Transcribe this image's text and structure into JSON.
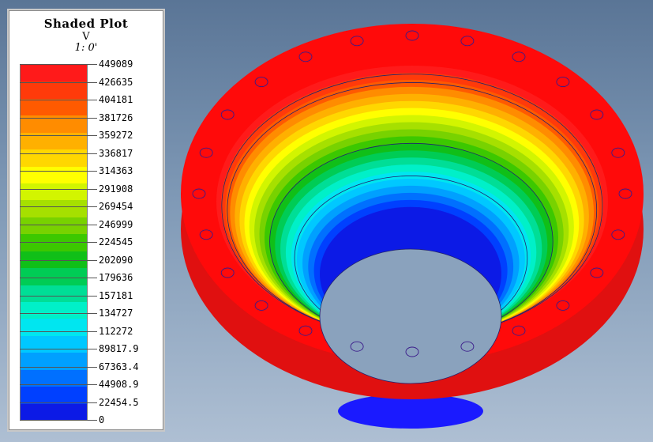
{
  "legend": {
    "title": "Shaded Plot",
    "quantity": "V",
    "scale": "1: 0'",
    "labels": [
      "449089",
      "426635",
      "404181",
      "381726",
      "359272",
      "336817",
      "314363",
      "291908",
      "269454",
      "246999",
      "224545",
      "202090",
      "179636",
      "157181",
      "134727",
      "112272",
      "89817.9",
      "67363.4",
      "44908.9",
      "22454.5",
      "0"
    ],
    "band_colors": [
      "#ff1a1a",
      "#ff3a0a",
      "#ff5a00",
      "#ff8c00",
      "#ffb000",
      "#ffd700",
      "#ffff00",
      "#d2f500",
      "#a6e000",
      "#78d200",
      "#3cc800",
      "#10bf18",
      "#00cc55",
      "#00de96",
      "#00f0c8",
      "#00e6f0",
      "#00c8ff",
      "#00a0ff",
      "#0070ff",
      "#0040ff",
      "#0c1ae6"
    ]
  },
  "model": {
    "flange_color": "#ff0a0a",
    "flange_shadow_color": "#e01010",
    "bottom_color": "#1a1aff",
    "hole_outline_color": "#3a1a8a",
    "contour_line_color": "#22226e"
  }
}
